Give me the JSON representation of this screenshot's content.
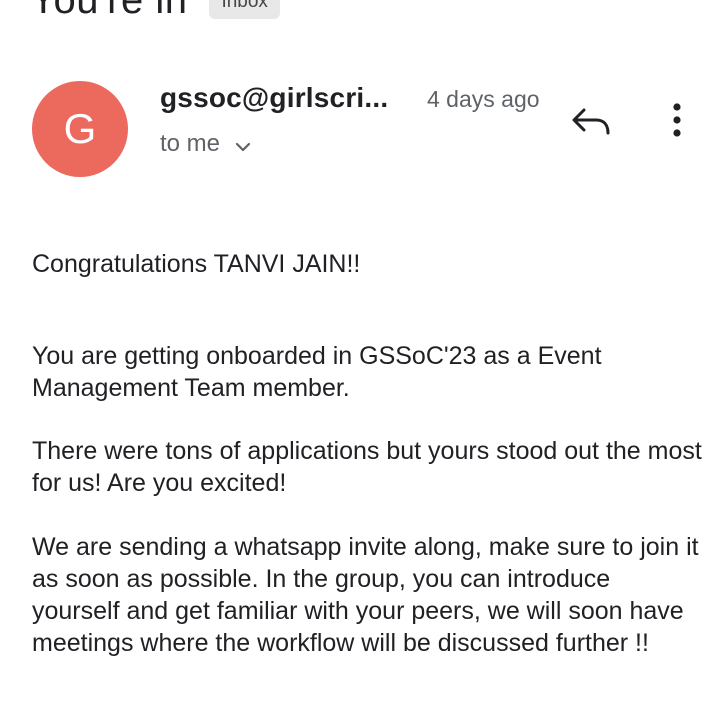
{
  "subject": {
    "title": "You're in",
    "label_chip": "Inbox"
  },
  "message": {
    "avatar_letter": "G",
    "avatar_color": "#ec6a5d",
    "sender": "gssoc@girlscri...",
    "time": "4 days ago",
    "recipient": "to me",
    "icons": {
      "reply": "reply-icon",
      "more": "more-vert-icon",
      "expand": "chevron-down-icon"
    }
  },
  "body": {
    "greeting": "Congratulations TANVI JAIN!!",
    "paragraphs": [
      "You are getting onboarded in GSSoC'23 as a Event Management Team member.",
      "There were tons of applications but yours stood out the most for us! Are you excited!",
      "We are sending a whatsapp invite along, make sure to join it as soon as possible. In the group, you can introduce yourself and get familiar with your peers, we will soon have meetings where the workflow will be discussed further !!"
    ]
  }
}
